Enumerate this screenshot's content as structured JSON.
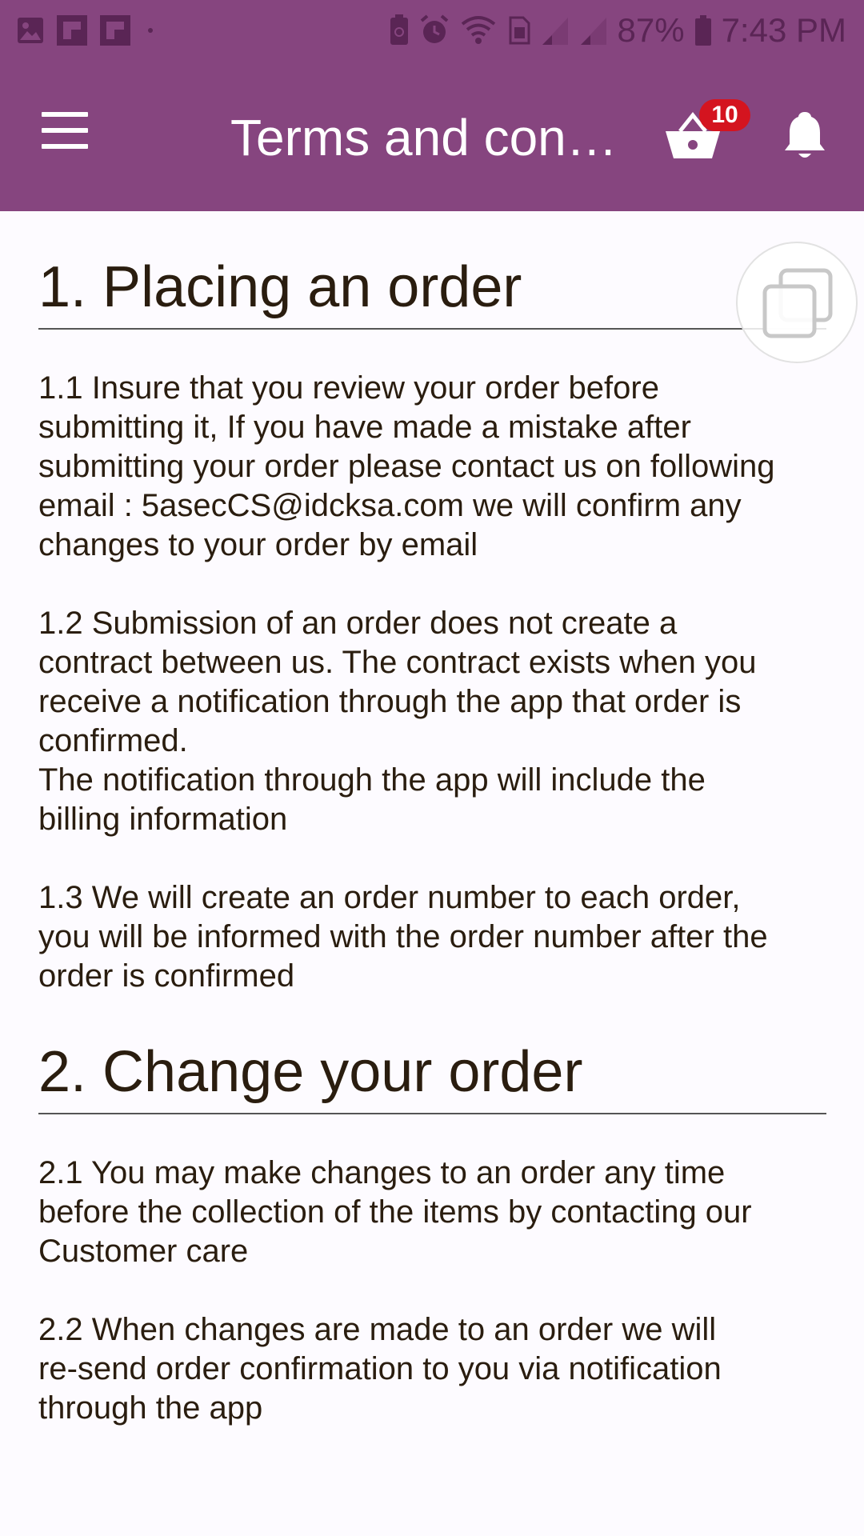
{
  "status_bar": {
    "battery_percent": "87%",
    "time": "7:43 PM",
    "left_icons": [
      "gallery-icon",
      "flipboard-icon",
      "flipboard-icon",
      "dot-icon"
    ],
    "right_icons": [
      "battery-saver-icon",
      "alarm-icon",
      "wifi-icon",
      "sim-icon",
      "signal-icon",
      "signal-icon",
      "battery-icon"
    ]
  },
  "toolbar": {
    "title": "Terms and con…",
    "cart_badge": "10",
    "colors": {
      "bar": "#86457f",
      "badge": "#d4141f"
    }
  },
  "sections": [
    {
      "title": "1. Placing an order",
      "paragraphs": [
        "1.1 Insure that you review your order before\nsubmitting it, If you have made a mistake after\nsubmitting your order please contact us on following\nemail : 5asecCS@idcksa.com we will confirm any\nchanges to your order by email",
        "1.2 Submission of an order does not create a\ncontract between us. The contract exists when you\nreceive a notification through the app that order is\nconfirmed.\nThe notification through the app will include the\nbilling information",
        "1.3 We will create an order number to each order,\nyou will be informed with the order number after the\norder is confirmed"
      ]
    },
    {
      "title": "2. Change your order",
      "paragraphs": [
        "2.1 You may make changes to an order any time\nbefore the collection of the items by contacting our\nCustomer care",
        "2.2 When changes are made to an order we will\nre-send order confirmation to you via notification\nthrough the app"
      ]
    }
  ]
}
